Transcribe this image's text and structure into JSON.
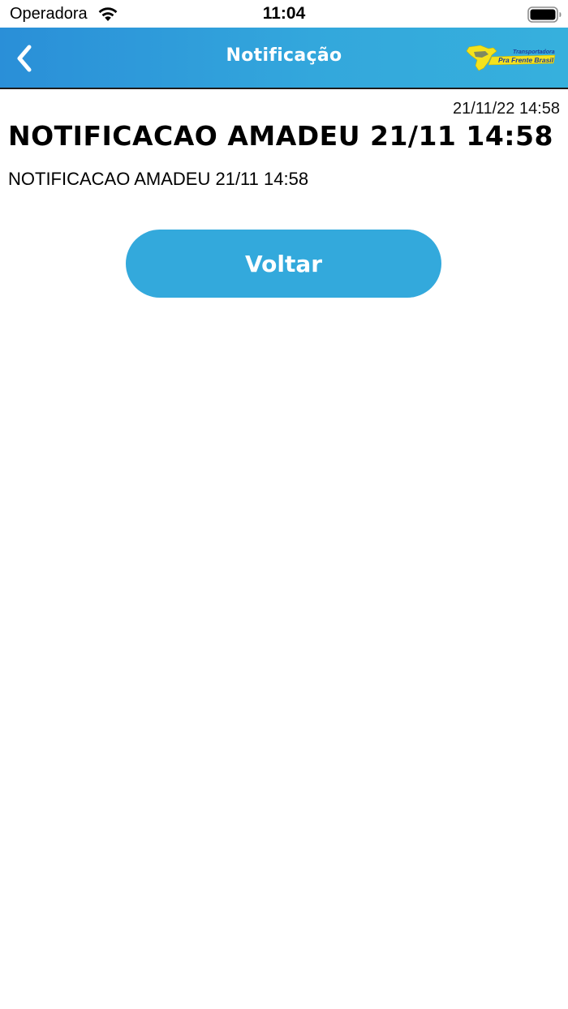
{
  "status_bar": {
    "carrier": "Operadora",
    "time": "11:04",
    "wifi_icon": "wifi-icon",
    "battery_icon": "battery-icon"
  },
  "nav": {
    "title": "Notificação",
    "back_icon": "chevron-left-icon",
    "logo": {
      "name": "transportadora-pra-frente-brasil-logo",
      "line1": "Transportadora",
      "line2": "Pra Frente Brasil"
    }
  },
  "notification": {
    "timestamp": "21/11/22 14:58",
    "title": "NOTIFICACAO AMADEU 21/11 14:58",
    "body": "NOTIFICACAO AMADEU 21/11 14:58"
  },
  "actions": {
    "back_label": "Voltar"
  },
  "colors": {
    "nav_gradient_start": "#2a8fd8",
    "nav_gradient_end": "#36b0dd",
    "button_bg": "#33a9dc",
    "logo_yellow": "#f5e21c",
    "logo_blue": "#1f3f9a"
  }
}
